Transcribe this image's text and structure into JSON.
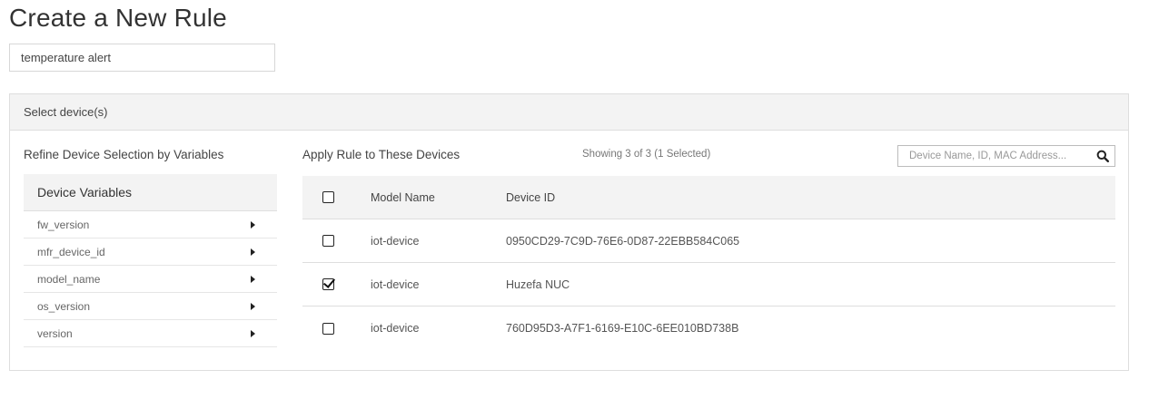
{
  "page": {
    "title": "Create a New Rule",
    "rule_name_value": "temperature alert",
    "rule_name_placeholder": ""
  },
  "panel": {
    "header": "Select device(s)",
    "left": {
      "title": "Refine Device Selection by Variables",
      "variables_header": "Device Variables",
      "variables": [
        {
          "label": "fw_version"
        },
        {
          "label": "mfr_device_id"
        },
        {
          "label": "model_name"
        },
        {
          "label": "os_version"
        },
        {
          "label": "version"
        }
      ]
    },
    "right": {
      "title": "Apply Rule to These Devices",
      "showing": "Showing 3 of 3 (1 Selected)",
      "search_placeholder": "Device Name, ID, MAC Address...",
      "search_icon": "search-icon",
      "columns": {
        "model": "Model Name",
        "device_id": "Device ID"
      },
      "header_checked": false,
      "rows": [
        {
          "model": "iot-device",
          "device_id": "0950CD29-7C9D-76E6-0D87-22EBB584C065",
          "checked": false
        },
        {
          "model": "iot-device",
          "device_id": "Huzefa NUC",
          "checked": true
        },
        {
          "model": "iot-device",
          "device_id": "760D95D3-A7F1-6169-E10C-6EE010BD738B",
          "checked": false
        }
      ]
    }
  }
}
